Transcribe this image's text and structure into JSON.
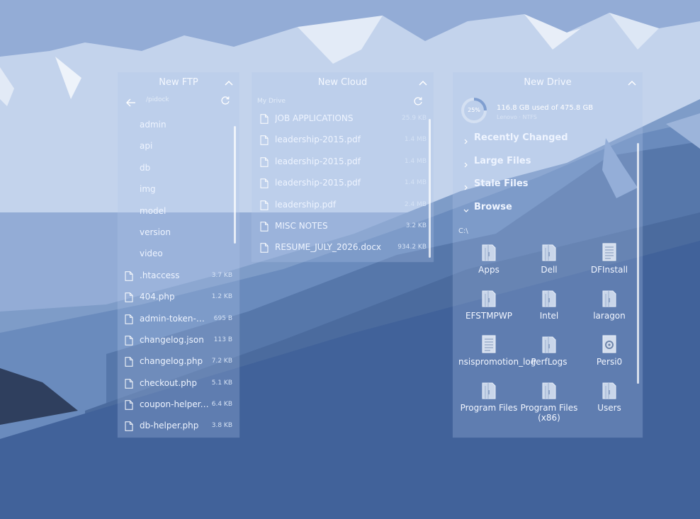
{
  "colors": {
    "sky": "#93acd6",
    "deep": "#3f5f8f",
    "panel": "#b0c7e8"
  },
  "ftp": {
    "title": "New FTP",
    "path": "/pidock",
    "folders": [
      "admin",
      "api",
      "db",
      "img",
      "model",
      "version",
      "video"
    ],
    "files": [
      {
        "name": ".htaccess",
        "size": "3.7 KB"
      },
      {
        "name": "404.php",
        "size": "1.2 KB"
      },
      {
        "name": "admin-token-co...",
        "size": "695 B"
      },
      {
        "name": "changelog.json",
        "size": "113 B"
      },
      {
        "name": "changelog.php",
        "size": "7.2 KB"
      },
      {
        "name": "checkout.php",
        "size": "5.1 KB"
      },
      {
        "name": "coupon-helper....",
        "size": "6.4 KB"
      },
      {
        "name": "db-helper.php",
        "size": "3.8 KB"
      }
    ]
  },
  "cloud": {
    "title": "New Cloud",
    "path": "My Drive",
    "items": [
      {
        "name": "JOB APPLICATIONS",
        "size": "25.9 KB"
      },
      {
        "name": "leadership-2015.pdf",
        "size": "1.4 MB"
      },
      {
        "name": "leadership-2015.pdf",
        "size": "1.4 MB"
      },
      {
        "name": "leadership-2015.pdf",
        "size": "1.4 MB"
      },
      {
        "name": "leadership.pdf",
        "size": "2.4 MB"
      },
      {
        "name": "MISC NOTES",
        "size": "3.2 KB"
      },
      {
        "name": "RESUME_JULY_2026.docx",
        "size": "934.2 KB"
      }
    ]
  },
  "drive": {
    "title": "New Drive",
    "usage_percent_label": "25%",
    "usage_fraction": 0.25,
    "usage_text": "116.8 GB used of 475.8 GB",
    "sub_text": "Lenovo · NTFS",
    "sections": [
      "Recently Changed",
      "Large Files",
      "Stale Files",
      "Browse"
    ],
    "browse_path": "C:\\",
    "items": [
      {
        "name": "Apps",
        "icon": "folder-icon"
      },
      {
        "name": "Dell",
        "icon": "folder-icon"
      },
      {
        "name": "DFInstall",
        "icon": "document-icon"
      },
      {
        "name": "EFSTMPWP",
        "icon": "folder-icon"
      },
      {
        "name": "Intel",
        "icon": "folder-icon"
      },
      {
        "name": "laragon",
        "icon": "folder-icon"
      },
      {
        "name": "nsispromotion_log",
        "icon": "document-icon"
      },
      {
        "name": "PerfLogs",
        "icon": "folder-icon"
      },
      {
        "name": "Persi0",
        "icon": "settings-file-icon"
      },
      {
        "name": "Program Files",
        "icon": "folder-icon"
      },
      {
        "name": "Program Files (x86)",
        "icon": "folder-icon"
      },
      {
        "name": "Users",
        "icon": "folder-icon"
      }
    ]
  }
}
